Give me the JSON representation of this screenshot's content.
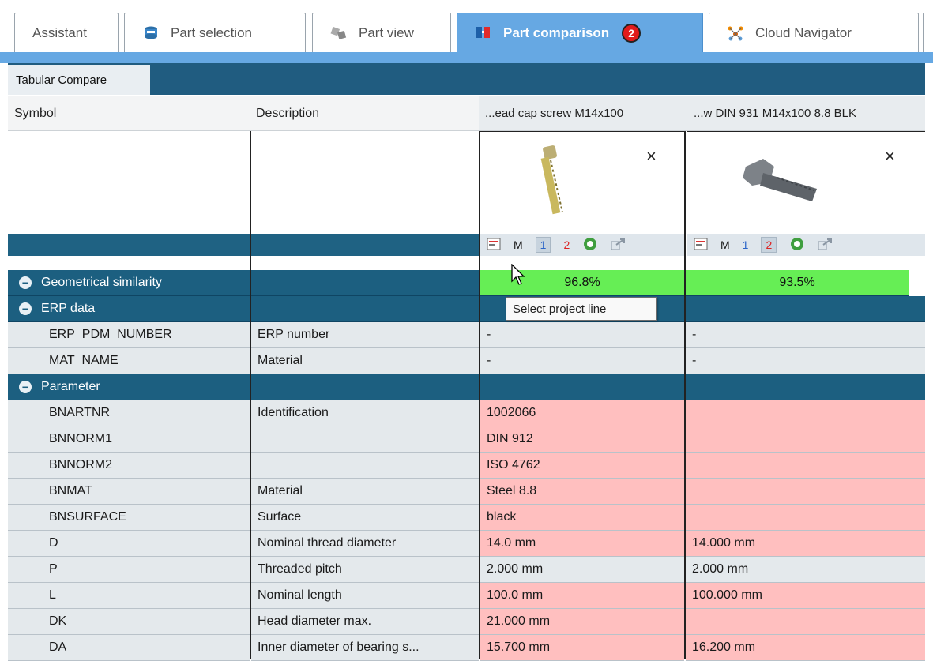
{
  "tabs": [
    {
      "label": "Assistant",
      "icon": "",
      "active": false
    },
    {
      "label": "Part selection",
      "icon": "catalog-icon",
      "active": false
    },
    {
      "label": "Part view",
      "icon": "part-view-icon",
      "active": false
    },
    {
      "label": "Part comparison",
      "icon": "part-comparison-icon",
      "active": true,
      "badge": "2"
    },
    {
      "label": "Cloud Navigator",
      "icon": "cloud-navigator-icon",
      "active": false
    }
  ],
  "subtab": {
    "label": "Tabular Compare"
  },
  "headers": {
    "symbol": "Symbol",
    "description": "Description",
    "part1": "...ead cap screw M14x100",
    "part2": "...w DIN 931 M14x100 8.8 BLK"
  },
  "close_glyph": "×",
  "toolbar": {
    "m": "M",
    "one": "1",
    "two": "2"
  },
  "groups": {
    "geom": {
      "label": "Geometrical similarity",
      "p1": "96.8%",
      "p2": "93.5%"
    },
    "erp": {
      "label": "ERP data"
    },
    "param": {
      "label": "Parameter"
    }
  },
  "erp_rows": [
    {
      "symbol": "ERP_PDM_NUMBER",
      "desc": "ERP number",
      "p1": "-",
      "p2": "-"
    },
    {
      "symbol": "MAT_NAME",
      "desc": "Material",
      "p1": "-",
      "p2": "-"
    }
  ],
  "param_rows": [
    {
      "symbol": "BNARTNR",
      "desc": "Identification",
      "p1": "1002066",
      "p2": ""
    },
    {
      "symbol": "BNNORM1",
      "desc": "",
      "p1": "DIN 912",
      "p2": ""
    },
    {
      "symbol": "BNNORM2",
      "desc": "",
      "p1": "ISO 4762",
      "p2": ""
    },
    {
      "symbol": "BNMAT",
      "desc": "Material",
      "p1": "Steel 8.8",
      "p2": ""
    },
    {
      "symbol": "BNSURFACE",
      "desc": "Surface",
      "p1": "black",
      "p2": ""
    },
    {
      "symbol": "D",
      "desc": "Nominal thread diameter",
      "p1": "14.0 mm",
      "p2": "14.000 mm"
    },
    {
      "symbol": "P",
      "desc": "Threaded pitch",
      "p1": "2.000 mm",
      "p2": "2.000 mm"
    },
    {
      "symbol": "L",
      "desc": "Nominal length",
      "p1": "100.0 mm",
      "p2": "100.000 mm"
    },
    {
      "symbol": "DK",
      "desc": "Head diameter max.",
      "p1": "21.000 mm",
      "p2": ""
    },
    {
      "symbol": "DA",
      "desc": "Inner diameter of bearing s...",
      "p1": "15.700 mm",
      "p2": "16.200 mm"
    }
  ],
  "tooltip": "Select project line",
  "colors": {
    "accent": "#66a8e3",
    "group": "#1c5f80",
    "diff": "#ffbfbf",
    "similar": "#66ee55",
    "badge": "#e11b1b"
  }
}
